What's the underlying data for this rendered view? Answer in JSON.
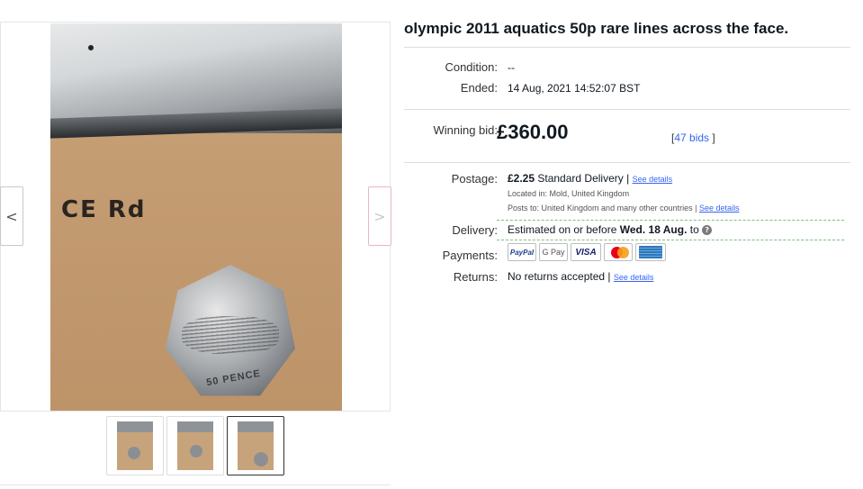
{
  "listing": {
    "title": "olympic 2011 aquatics 50p rare lines across the face."
  },
  "gallery": {
    "prev_arrow": "<",
    "next_arrow": ">",
    "photo_ce_text": "CE Rd",
    "coin_text": "50 PENCE",
    "thumbnails": [
      {
        "name": "thumb-1",
        "selected": false
      },
      {
        "name": "thumb-2",
        "selected": false
      },
      {
        "name": "thumb-3",
        "selected": true
      }
    ]
  },
  "details": {
    "condition_label": "Condition:",
    "condition_value": "--",
    "ended_label": "Ended:",
    "ended_value": "14 Aug, 2021 14:52:07 BST",
    "winning_bid_label": "Winning bid:",
    "winning_bid_value": "£360.00",
    "bids_open": "[",
    "bids_link": "47 bids",
    "bids_close": "]",
    "postage_label": "Postage:",
    "postage_price": "£2.25",
    "postage_service": "Standard Delivery |",
    "postage_see_details": "See details",
    "located_in": "Located in: Mold, United Kingdom",
    "posts_to": "Posts to: United Kingdom and many other countries |",
    "posts_to_see_details": "See details",
    "delivery_label": "Delivery:",
    "delivery_prefix": "Estimated on or before",
    "delivery_date": "Wed. 18 Aug.",
    "delivery_suffix": "to",
    "help_icon": "?",
    "payments_label": "Payments:",
    "payments": {
      "paypal": "PayPal",
      "gpay": "G Pay",
      "visa": "VISA"
    },
    "returns_label": "Returns:",
    "returns_value": "No returns accepted |",
    "returns_see_details": "See details"
  },
  "colors": {
    "link": "#3665f3",
    "text": "#111820",
    "delivery_dash": "#7fbf7f"
  }
}
